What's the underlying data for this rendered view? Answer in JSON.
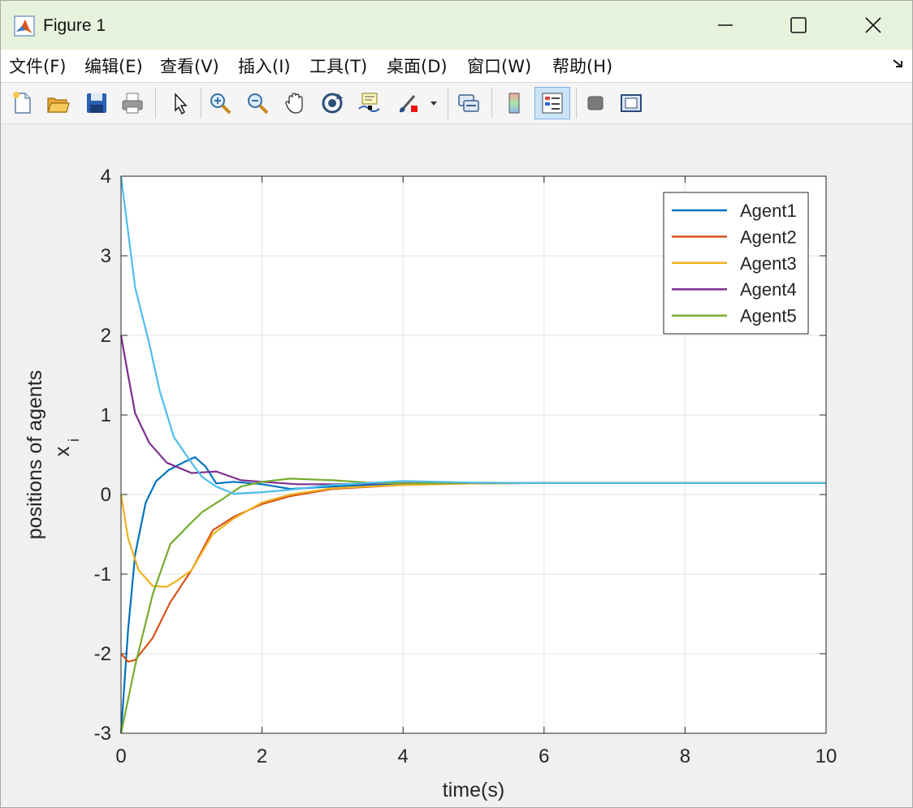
{
  "window": {
    "title": "Figure 1",
    "controls": [
      "minimize-icon",
      "maximize-icon",
      "close-icon"
    ]
  },
  "menu": {
    "items": [
      {
        "label": "文件(F)"
      },
      {
        "label": "编辑(E)"
      },
      {
        "label": "查看(V)"
      },
      {
        "label": "插入(I)"
      },
      {
        "label": "工具(T)"
      },
      {
        "label": "桌面(D)"
      },
      {
        "label": "窗口(W)"
      },
      {
        "label": "帮助(H)"
      }
    ]
  },
  "toolbar": {
    "icons": [
      "new-figure-icon",
      "open-file-icon",
      "save-icon",
      "print-icon",
      "edit-plot-arrow-icon",
      "zoom-in-icon",
      "zoom-out-icon",
      "pan-hand-icon",
      "rotate-3d-icon",
      "data-cursor-icon",
      "brush-icon",
      "brush-dropdown-icon",
      "link-plot-icon",
      "colorbar-icon",
      "legend-icon",
      "hide-plot-tools-icon",
      "show-plot-tools-icon"
    ],
    "active": "legend-icon"
  },
  "chart_data": {
    "type": "line",
    "xlabel": "time(s)",
    "ylabel_line1": "positions of agents",
    "ylabel_line2": "x",
    "ylabel_subscript": "i",
    "xlim": [
      0,
      10
    ],
    "ylim": [
      -3,
      4
    ],
    "xticks": [
      0,
      2,
      4,
      6,
      8,
      10
    ],
    "yticks": [
      -3,
      -2,
      -1,
      0,
      1,
      2,
      3,
      4
    ],
    "grid": true,
    "legend_position": "top-right",
    "series": [
      {
        "name": "Agent1",
        "color": "#0072BD",
        "points": [
          [
            0,
            -3
          ],
          [
            0.1,
            -1.7
          ],
          [
            0.2,
            -0.75
          ],
          [
            0.35,
            -0.1
          ],
          [
            0.5,
            0.17
          ],
          [
            0.68,
            0.31
          ],
          [
            0.9,
            0.41
          ],
          [
            1.05,
            0.47
          ],
          [
            1.2,
            0.35
          ],
          [
            1.35,
            0.14
          ],
          [
            1.6,
            0.16
          ],
          [
            2,
            0.13
          ],
          [
            2.4,
            0.07
          ],
          [
            3,
            0.1
          ],
          [
            4,
            0.14
          ],
          [
            5,
            0.145
          ],
          [
            6,
            0.145
          ],
          [
            8,
            0.145
          ],
          [
            10,
            0.145
          ]
        ]
      },
      {
        "name": "Agent2",
        "color": "#D95319",
        "points": [
          [
            0,
            -2
          ],
          [
            0.1,
            -2.1
          ],
          [
            0.2,
            -2.08
          ],
          [
            0.45,
            -1.8
          ],
          [
            0.7,
            -1.35
          ],
          [
            1.0,
            -0.95
          ],
          [
            1.3,
            -0.45
          ],
          [
            1.6,
            -0.28
          ],
          [
            2,
            -0.12
          ],
          [
            2.4,
            -0.02
          ],
          [
            3,
            0.07
          ],
          [
            4,
            0.12
          ],
          [
            5,
            0.14
          ],
          [
            6,
            0.145
          ],
          [
            8,
            0.145
          ],
          [
            10,
            0.145
          ]
        ]
      },
      {
        "name": "Agent3",
        "color": "#EDB120",
        "points": [
          [
            0,
            0
          ],
          [
            0.1,
            -0.55
          ],
          [
            0.25,
            -0.95
          ],
          [
            0.45,
            -1.15
          ],
          [
            0.65,
            -1.16
          ],
          [
            0.8,
            -1.08
          ],
          [
            1.0,
            -0.95
          ],
          [
            1.3,
            -0.5
          ],
          [
            1.6,
            -0.3
          ],
          [
            2,
            -0.1
          ],
          [
            2.4,
            0.0
          ],
          [
            3,
            0.08
          ],
          [
            4,
            0.12
          ],
          [
            5,
            0.14
          ],
          [
            6,
            0.145
          ],
          [
            8,
            0.145
          ],
          [
            10,
            0.145
          ]
        ]
      },
      {
        "name": "Agent4",
        "color": "#7E2F8E",
        "points": [
          [
            0,
            2
          ],
          [
            0.1,
            1.5
          ],
          [
            0.2,
            1.02
          ],
          [
            0.4,
            0.65
          ],
          [
            0.65,
            0.4
          ],
          [
            1.0,
            0.27
          ],
          [
            1.35,
            0.29
          ],
          [
            1.7,
            0.18
          ],
          [
            2,
            0.16
          ],
          [
            2.5,
            0.13
          ],
          [
            3,
            0.13
          ],
          [
            4,
            0.145
          ],
          [
            5,
            0.145
          ],
          [
            6,
            0.145
          ],
          [
            8,
            0.145
          ],
          [
            10,
            0.145
          ]
        ]
      },
      {
        "name": "Agent5",
        "color": "#77AC30",
        "points": [
          [
            0,
            -3
          ],
          [
            0.2,
            -2.15
          ],
          [
            0.45,
            -1.25
          ],
          [
            0.7,
            -0.62
          ],
          [
            1.0,
            -0.35
          ],
          [
            1.15,
            -0.22
          ],
          [
            1.45,
            -0.05
          ],
          [
            1.7,
            0.1
          ],
          [
            2,
            0.16
          ],
          [
            2.4,
            0.2
          ],
          [
            3,
            0.18
          ],
          [
            3.5,
            0.15
          ],
          [
            4,
            0.14
          ],
          [
            5,
            0.145
          ],
          [
            6,
            0.145
          ],
          [
            8,
            0.145
          ],
          [
            10,
            0.145
          ]
        ]
      },
      {
        "name": "",
        "color": "#4DBEEE",
        "points": [
          [
            0,
            4
          ],
          [
            0.1,
            3.3
          ],
          [
            0.2,
            2.6
          ],
          [
            0.4,
            1.9
          ],
          [
            0.55,
            1.3
          ],
          [
            0.75,
            0.72
          ],
          [
            1.0,
            0.4
          ],
          [
            1.15,
            0.22
          ],
          [
            1.35,
            0.1
          ],
          [
            1.6,
            0.01
          ],
          [
            2,
            0.03
          ],
          [
            2.4,
            0.06
          ],
          [
            3,
            0.12
          ],
          [
            4,
            0.17
          ],
          [
            5,
            0.15
          ],
          [
            6,
            0.145
          ],
          [
            8,
            0.145
          ],
          [
            10,
            0.145
          ]
        ]
      }
    ]
  }
}
